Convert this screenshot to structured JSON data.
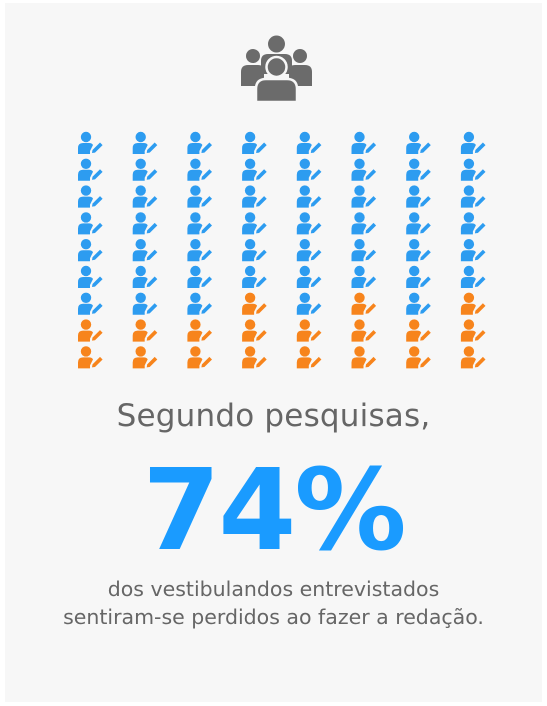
{
  "infographic": {
    "icon": "group-users-icon",
    "heading": "Segundo pesquisas,",
    "percentage": "74%",
    "description": "dos vestibulandos entrevistados sentiram-se perdidos ao fazer a redação.",
    "person_icon": "user-edit-icon",
    "grid": {
      "columns": 8,
      "rows": 9,
      "highlighted_count": 53,
      "total_count": 72
    },
    "colors": {
      "highlight": "#2d9cf0",
      "other": "#f7841c",
      "percentage": "#1a9bff",
      "text": "#666666",
      "group_icon": "#6b6b6b",
      "background": "#f7f7f7"
    }
  }
}
